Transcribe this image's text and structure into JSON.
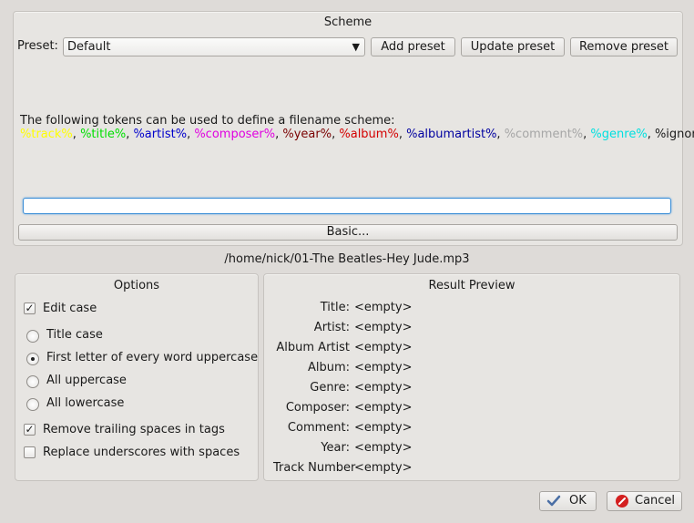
{
  "scheme": {
    "title": "Scheme",
    "preset_label": "Preset:",
    "preset_value": "Default",
    "add_preset": "Add preset",
    "update_preset": "Update preset",
    "remove_preset": "Remove preset",
    "tokens_intro": "The following tokens can be used to define a filename scheme:",
    "tokens": [
      {
        "text": "%track%",
        "color": "#ffff00"
      },
      {
        "text": "%title%",
        "color": "#00e000"
      },
      {
        "text": "%artist%",
        "color": "#0000cc"
      },
      {
        "text": "%composer%",
        "color": "#e000e0"
      },
      {
        "text": "%year%",
        "color": "#7a0000"
      },
      {
        "text": "%album%",
        "color": "#d40000"
      },
      {
        "text": "%albumartist%",
        "color": "#0000a0"
      },
      {
        "text": "%comment%",
        "color": "#a6a6a6"
      },
      {
        "text": "%genre%",
        "color": "#00e0e0"
      },
      {
        "text": "%ignore%",
        "color": "#1a1a1a"
      }
    ],
    "scheme_input_value": "",
    "basic_button": "Basic..."
  },
  "file_path": "/home/nick/01-The Beatles-Hey Jude.mp3",
  "options": {
    "title": "Options",
    "edit_case": {
      "label": "Edit case",
      "checked": true
    },
    "case_options": [
      {
        "label": "Title case",
        "selected": false
      },
      {
        "label": "First letter of every word uppercase",
        "selected": true
      },
      {
        "label": "All uppercase",
        "selected": false
      },
      {
        "label": "All lowercase",
        "selected": false
      }
    ],
    "remove_trailing": {
      "label": "Remove trailing spaces in tags",
      "checked": true
    },
    "replace_underscores": {
      "label": "Replace underscores with spaces",
      "checked": false
    }
  },
  "preview": {
    "title": "Result Preview",
    "rows": [
      {
        "key": "Title:",
        "value": "<empty>"
      },
      {
        "key": "Artist:",
        "value": "<empty>"
      },
      {
        "key": "Album Artist",
        "value": "<empty>"
      },
      {
        "key": "Album:",
        "value": "<empty>"
      },
      {
        "key": "Genre:",
        "value": "<empty>"
      },
      {
        "key": "Composer:",
        "value": "<empty>"
      },
      {
        "key": "Comment:",
        "value": "<empty>"
      },
      {
        "key": "Year:",
        "value": "<empty>"
      },
      {
        "key": "Track Number",
        "value": "<empty>"
      }
    ]
  },
  "dialog": {
    "ok": "OK",
    "cancel": "Cancel",
    "ok_icon": "checkmark-icon",
    "cancel_icon": "cancel-icon"
  }
}
